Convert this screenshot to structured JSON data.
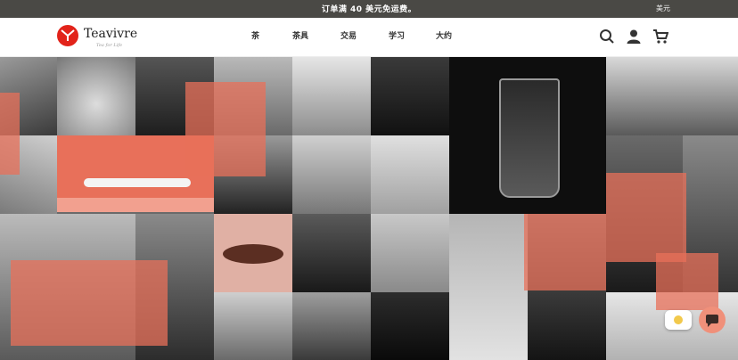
{
  "topbar": {
    "message": "订单满 40 美元免运费。",
    "currency": "美元"
  },
  "header": {
    "brand": "Teavivre",
    "tagline": "Tea for Life",
    "nav": [
      {
        "label": "茶"
      },
      {
        "label": "茶具"
      },
      {
        "label": "交易"
      },
      {
        "label": "学习"
      },
      {
        "label": "大约"
      }
    ],
    "icons": [
      "search-icon",
      "account-icon",
      "cart-icon"
    ]
  },
  "colors": {
    "brand_red": "#e2231a",
    "overlay_coral": "#e8705a",
    "topbar_bg": "#4a4945"
  },
  "widgets": {
    "chat_icon": "chat-bubble-icon",
    "ghost_icon": "sparkle-icon"
  }
}
